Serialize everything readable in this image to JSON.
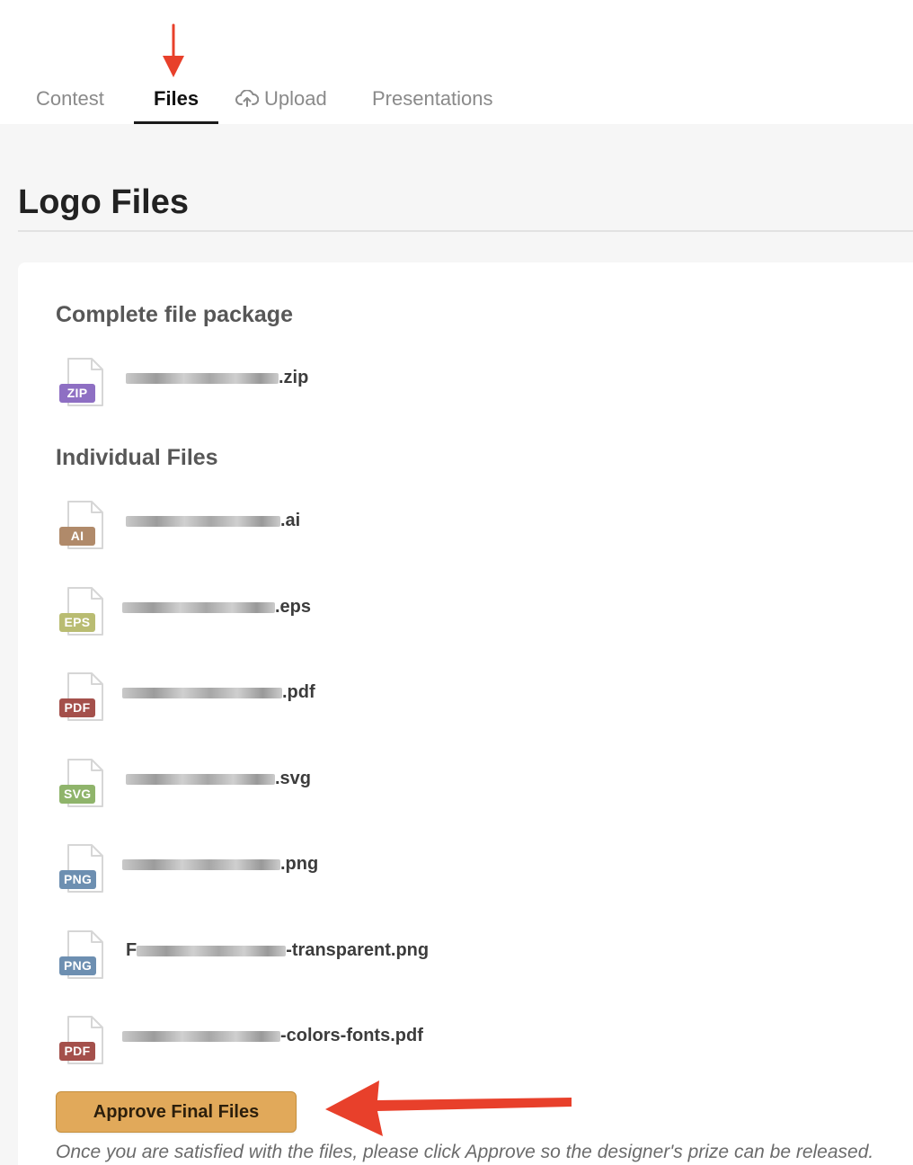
{
  "tabs": {
    "contest": "Contest",
    "files": "Files",
    "upload": "Upload",
    "presentations": "Presentations",
    "active": "files"
  },
  "page": {
    "title": "Logo Files"
  },
  "package": {
    "heading": "Complete file package",
    "file": {
      "badge": "ZIP",
      "badge_color": "#8e6fc3",
      "suffix": ".zip"
    }
  },
  "individual": {
    "heading": "Individual Files",
    "files": [
      {
        "badge": "AI",
        "badge_color": "#b08a6a",
        "prefix": "",
        "suffix": ".ai"
      },
      {
        "badge": "EPS",
        "badge_color": "#b9bc72",
        "prefix": "",
        "suffix": ".eps"
      },
      {
        "badge": "PDF",
        "badge_color": "#a4504b",
        "prefix": "",
        "suffix": ".pdf"
      },
      {
        "badge": "SVG",
        "badge_color": "#8fb46b",
        "prefix": "",
        "suffix": ".svg"
      },
      {
        "badge": "PNG",
        "badge_color": "#6d8fb1",
        "prefix": "",
        "suffix": ".png"
      },
      {
        "badge": "PNG",
        "badge_color": "#6d8fb1",
        "prefix": "F",
        "suffix": "-transparent.png"
      },
      {
        "badge": "PDF",
        "badge_color": "#a4504b",
        "prefix": "",
        "suffix": "-colors-fonts.pdf"
      }
    ]
  },
  "approve": {
    "button_label": "Approve Final Files",
    "note": "Once you are satisfied with the files, please click Approve so the designer's prize can be released."
  },
  "colors": {
    "accent_button": "#e1a95a",
    "annotation_arrow": "#e8402b"
  },
  "icons": {
    "file": "document-icon",
    "upload": "cloud-upload-icon",
    "annotation": "red-arrow"
  }
}
